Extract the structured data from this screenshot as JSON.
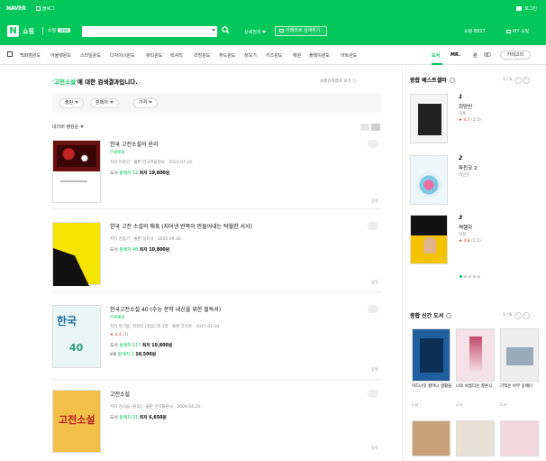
{
  "topbar": {
    "brand": "NAVER",
    "blog": "블로그",
    "login": "로그인"
  },
  "header": {
    "logo": "N",
    "shop_title": "쇼핑",
    "shop_live": "쇼핑",
    "live_badge": "LIVE",
    "search_value": "",
    "detail_search": "상세검색",
    "camera_search": "카메라로 검색하기",
    "best": "쇼핑 BEST",
    "mypage": "MY 쇼핑"
  },
  "catnav": {
    "items": [
      "백화점윈도",
      "아울렛윈도",
      "스타일윈도",
      "디자이너윈도",
      "뷰티윈도",
      "럭셔리",
      "리빙윈도",
      "푸드윈도",
      "장보기",
      "키즈윈도",
      "펫윈",
      "플레이윈도",
      "아트윈도",
      "도서"
    ],
    "active": "도서",
    "brand1": "MR.",
    "brand2": "윈",
    "more": "카테고리"
  },
  "results": {
    "query": "'고전소설'",
    "suffix": "에 대한 검색결과입니다.",
    "report": "쇼핑검색결과 보기 ⓘ",
    "filters": [
      "출판",
      "판매처",
      "가격"
    ],
    "sort": "네이버 랭킹순"
  },
  "items": [
    {
      "title": "한국 고전소설의 윤리",
      "free": "무료배송",
      "meta": "저자 이종인 · 출판 한국학술정보 · 2022.07.24.",
      "price_label": "도서",
      "lowest": "판매처 12",
      "price": "최저 19,800원",
      "share": "공유"
    },
    {
      "title": "한국 고전 소설의 매혹 (지어낸 반복이 만들어내는 탁월한 서사)",
      "meta": "저자 김종기 · 출판 일지사 · 2020.09.30.",
      "price_label": "도서",
      "lowest": "판매처 48",
      "price": "최저 10,800원",
      "share": "공유"
    },
    {
      "title": "한국고전소설 40 (수능 문학 내신을 위한 필독서)",
      "free": "무료배송",
      "meta": "저자 박기용, 최영희 (엮음) 외 1명 · 출판 자유로 · 2015.01.10.",
      "stars": "★ 4.4",
      "stars_count": "(7)",
      "price_label": "도서",
      "lowest": "판매처 117",
      "price": "최저 10,800원",
      "ebook_label": "e북",
      "ebook_lowest": "판매처 1",
      "ebook_price": "10,500원",
      "share": "공유"
    },
    {
      "title": "고전소설",
      "meta": "저자 김시습 (원작) · 출판 신라출판사 · 2009.04.20.",
      "price_label": "도서",
      "lowest": "판매처 21",
      "price": "최저 6,650원",
      "share": "공유"
    }
  ],
  "covers": {
    "c3_big": "한국",
    "c3_num": "40",
    "c4": "고전소설"
  },
  "sidebar": {
    "best_title": "종합 베스트셀러",
    "pager": [
      "1",
      "5"
    ],
    "best": [
      {
        "rank": "1",
        "title": "희망빈",
        "author": "김훈",
        "rating": "★ 4.7",
        "count": "(1.5)"
      },
      {
        "rank": "2",
        "title": "파친코 2",
        "author": "이민진",
        "rating": "",
        "count": ""
      },
      {
        "rank": "3",
        "title": "역행자",
        "author": "자청",
        "rating": "★ 4.8",
        "count": "(1.1)"
      }
    ],
    "new_title": "종합 신간 도서",
    "new_pager": [
      "1",
      "6"
    ],
    "new_books": [
      {
        "title": "미드나잇 할머니 생활을",
        "author": "도서"
      },
      {
        "title": "나의 아름다운 결혼식",
        "author": "도서"
      },
      {
        "title": "기적은 아무 곳에나",
        "author": "도서"
      }
    ]
  }
}
